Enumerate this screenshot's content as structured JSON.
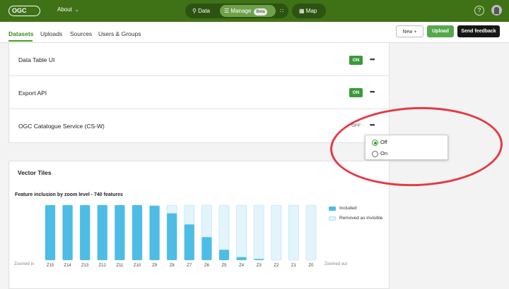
{
  "topbar": {
    "logo": "OGC",
    "about": "About",
    "nav": {
      "data": "Data",
      "manage": "Manage",
      "beta": "Beta",
      "map": "Map"
    },
    "help": "?"
  },
  "subnav": {
    "tabs": [
      "Datasets",
      "Uploads",
      "Sources",
      "Users & Groups"
    ],
    "new_label": "New",
    "upload_label": "Upload",
    "feedback_label": "Send feedback"
  },
  "services": [
    {
      "label": "Data Table UI",
      "state": "ON"
    },
    {
      "label": "Export API",
      "state": "ON"
    },
    {
      "label": "OGC Catalogue Service (CS-W)",
      "state": "OFF"
    }
  ],
  "more": "•••",
  "dropdown": {
    "options": [
      "Off",
      "On"
    ],
    "selected": "Off"
  },
  "vector_tiles": {
    "title": "Vector Tiles"
  },
  "chart_data": {
    "type": "bar",
    "title": "Feature inclusion by zoom level - 740 features",
    "categories": [
      "Z15",
      "Z14",
      "Z13",
      "Z12",
      "Z11",
      "Z10",
      "Z9",
      "Z8",
      "Z7",
      "Z6",
      "Z5",
      "Z4",
      "Z3",
      "Z2",
      "Z1",
      "Z0"
    ],
    "series": [
      {
        "name": "Included",
        "values": [
          740,
          740,
          740,
          740,
          740,
          740,
          730,
          630,
          480,
          310,
          140,
          40,
          15,
          0,
          0,
          0
        ]
      },
      {
        "name": "Removed as invisible",
        "values": [
          0,
          0,
          0,
          0,
          0,
          0,
          10,
          110,
          260,
          430,
          600,
          700,
          725,
          740,
          740,
          740
        ]
      }
    ],
    "ylim": [
      0,
      740
    ],
    "x_left_note": "Zoomed in",
    "x_right_note": "Zoomed out",
    "legend_position": "top-right",
    "colors": {
      "included": "#4dbde6",
      "removed": "#e3f4fb",
      "border": "#b6dff0"
    }
  }
}
